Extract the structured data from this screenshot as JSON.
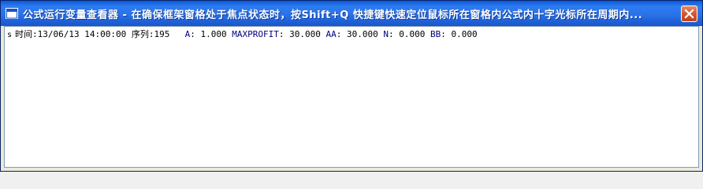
{
  "window": {
    "title": "公式运行变量查看器 - 在确保框架窗格处于焦点状态时，按Shift+Q 快捷键快速定位鼠标所在窗格内公式内十字光标所在周期内...",
    "close_icon": "close-icon",
    "title_icon": "window-icon"
  },
  "row": {
    "marker": "s",
    "time_label": "时间:",
    "time_value": "13/06/13 14:00:00",
    "seq_label": "序列:",
    "seq_value": "195",
    "vars": [
      {
        "name": "A",
        "value": "1.000"
      },
      {
        "name": "MAXPROFIT",
        "value": "30.000"
      },
      {
        "name": "AA",
        "value": "30.000"
      },
      {
        "name": "N",
        "value": "0.000"
      },
      {
        "name": "BB",
        "value": "0.000"
      }
    ]
  }
}
